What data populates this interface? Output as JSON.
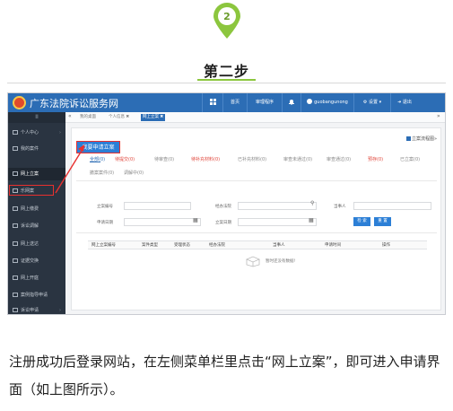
{
  "step": {
    "number": "2",
    "title": "第二步",
    "accent_color": "#8cc63e"
  },
  "app": {
    "title": "广东法院诉讼服务网",
    "brand_color": "#2c6db5",
    "nav": [
      {
        "icon": "grid-icon",
        "label": ""
      },
      {
        "icon": "",
        "label": "首页"
      },
      {
        "icon": "",
        "label": "审理程序"
      },
      {
        "icon": "bell-icon",
        "label": ""
      },
      {
        "icon": "user-icon",
        "label": "guobangunong"
      },
      {
        "icon": "gear-icon",
        "label": "设置 ▾"
      },
      {
        "icon": "logout-icon",
        "label": "退出"
      }
    ]
  },
  "sidebar": {
    "toggle": "II",
    "items": [
      {
        "label": "个人中心",
        "arrow": "›"
      },
      {
        "label": "我的案件",
        "arrow": ""
      },
      {
        "label": "网上立案",
        "arrow": ""
      },
      {
        "label": "乐网案",
        "arrow": ""
      },
      {
        "label": "网上缴费",
        "arrow": ""
      },
      {
        "label": "诉讼调解",
        "arrow": ""
      },
      {
        "label": "网上送达",
        "arrow": ""
      },
      {
        "label": "证据交换",
        "arrow": ""
      },
      {
        "label": "网上开庭",
        "arrow": ""
      },
      {
        "label": "案例指导申请",
        "arrow": ""
      },
      {
        "label": "诉讼申请",
        "arrow": "›"
      }
    ]
  },
  "tabs": {
    "back": "«",
    "forward": "»",
    "items": [
      {
        "label": "我的桌面",
        "current": false
      },
      {
        "label": "个人信息 ✖",
        "current": false
      },
      {
        "label": "网上立案 ✖",
        "current": true
      }
    ]
  },
  "panel": {
    "apply_button": "我要申请立案",
    "guide_link": "立案流程图»",
    "status_tabs": [
      {
        "label": "全部(0)",
        "color": "#2c6db5"
      },
      {
        "label": "待提交(0)",
        "color": "#e0453a"
      },
      {
        "label": "待审查(0)",
        "color": "#888888"
      },
      {
        "label": "待补充材料(0)",
        "color": "#e0453a"
      },
      {
        "label": "已补充材料(0)",
        "color": "#888888"
      },
      {
        "label": "审查未通过(0)",
        "color": "#888888"
      },
      {
        "label": "审查通过(0)",
        "color": "#888888"
      },
      {
        "label": "预存(0)",
        "color": "#e0453a"
      },
      {
        "label": "已立案(0)",
        "color": "#888888"
      },
      {
        "label": "撤案案件(0)",
        "color": "#888888"
      },
      {
        "label": "调解中(0)",
        "color": "#888888"
      }
    ],
    "form": {
      "case_no_label": "立案编号",
      "court_label": "经办法院",
      "party_label": "当事人",
      "apply_date_label": "申请日期",
      "filing_date_label": "立案日期",
      "search_button": "检 索",
      "reset_button": "重 置"
    },
    "table": {
      "columns": [
        "网上立案编号",
        "案件类型",
        "受理状态",
        "经办法院",
        "当事人",
        "申请时间",
        "操作"
      ],
      "empty_text": "暂时还没有数据!"
    }
  },
  "caption": "注册成功后登录网站，在左侧菜单栏里点击“网上立案”，即可进入申请界面（如上图所示）。"
}
